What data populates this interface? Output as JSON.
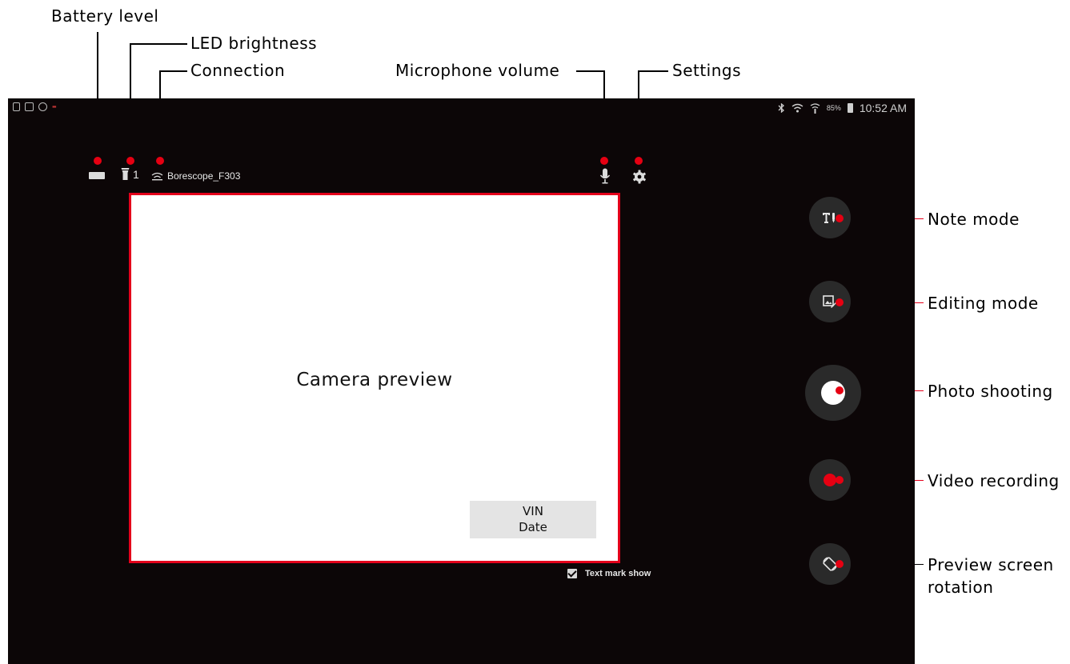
{
  "callouts": {
    "battery_level": "Battery level",
    "led_brightness": "LED brightness",
    "connection": "Connection",
    "microphone_volume": "Microphone volume",
    "settings": "Settings",
    "note_mode": "Note mode",
    "editing_mode": "Editing mode",
    "photo_shooting": "Photo shooting",
    "video_recording": "Video recording",
    "preview_rotation_line1": "Preview screen",
    "preview_rotation_line2": "rotation"
  },
  "status_bar": {
    "battery_percent": "85%",
    "time": "10:52 AM",
    "left_icons": [
      "screen-icon",
      "gallery-icon",
      "target-icon",
      "notification-icon"
    ],
    "right_icons": [
      "bluetooth-icon",
      "wifi-icon",
      "signal-icon",
      "battery-icon"
    ]
  },
  "topbar": {
    "led_level": "1",
    "connection_name": "Borescope_F303"
  },
  "preview": {
    "label": "Camera preview",
    "vin_label": "VIN",
    "date_label": "Date"
  },
  "text_mark": {
    "label": "Text mark show",
    "checked": true
  },
  "colors": {
    "accent": "#e4001b",
    "screen_bg": "#0c0607",
    "button_bg": "#2a2a2a",
    "record": "#e60012"
  }
}
